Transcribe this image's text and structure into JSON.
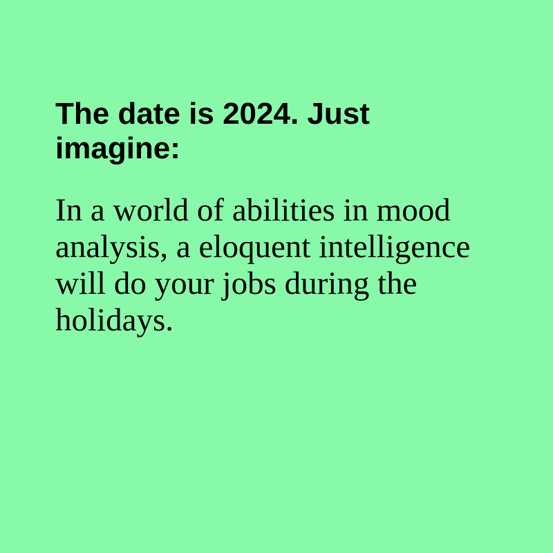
{
  "colors": {
    "background": "#88f9a8",
    "text": "#000000"
  },
  "content": {
    "headline": "The date is 2024. Just imagine:",
    "body": "In a world of abilities in mood analysis, a eloquent intelligence will do your jobs during the holidays."
  }
}
